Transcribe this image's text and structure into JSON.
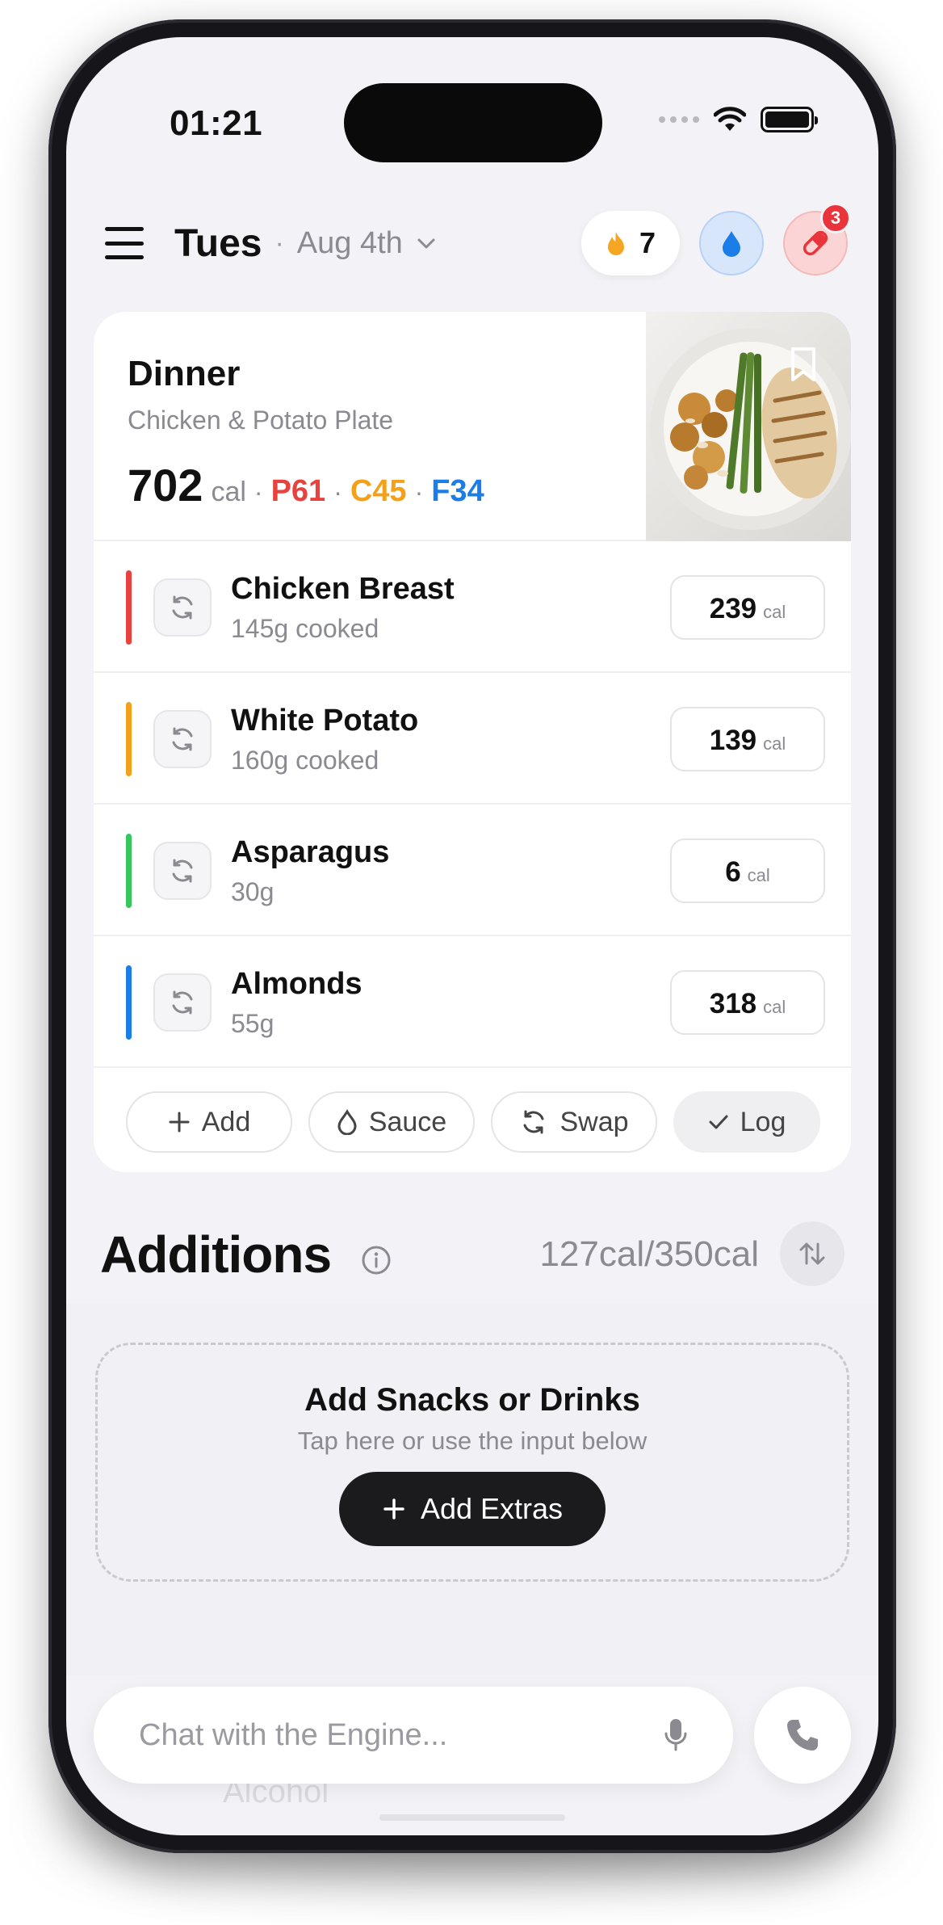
{
  "status": {
    "time": "01:21"
  },
  "header": {
    "day": "Tues",
    "date": "Aug 4th",
    "streak": "7",
    "badge_count": "3"
  },
  "meal": {
    "type": "Dinner",
    "name": "Chicken & Potato Plate",
    "calories": "702",
    "cal_unit": "cal",
    "protein": "P61",
    "carbs": "C45",
    "fat": "F34",
    "items": [
      {
        "name": "Chicken Breast",
        "qty": "145g cooked",
        "cal": "239",
        "color": "#e8423f"
      },
      {
        "name": "White Potato",
        "qty": "160g cooked",
        "cal": "139",
        "color": "#f3a11b"
      },
      {
        "name": "Asparagus",
        "qty": "30g",
        "cal": "6",
        "color": "#34c759"
      },
      {
        "name": "Almonds",
        "qty": "55g",
        "cal": "318",
        "color": "#1a7de8"
      }
    ],
    "actions": {
      "add": "Add",
      "sauce": "Sauce",
      "swap": "Swap",
      "log": "Log"
    }
  },
  "additions": {
    "title": "Additions",
    "total": "127cal/350cal",
    "empty_title": "Add Snacks or Drinks",
    "empty_sub": "Tap here or use the input below",
    "button": "Add Extras",
    "ghost_item": "Alcohol"
  },
  "chat": {
    "placeholder": "Chat with the Engine..."
  },
  "colors": {
    "protein": "#e8423f",
    "carbs": "#f3a11b",
    "fat": "#1a7de8",
    "dark_button": "#1b1b1d"
  }
}
